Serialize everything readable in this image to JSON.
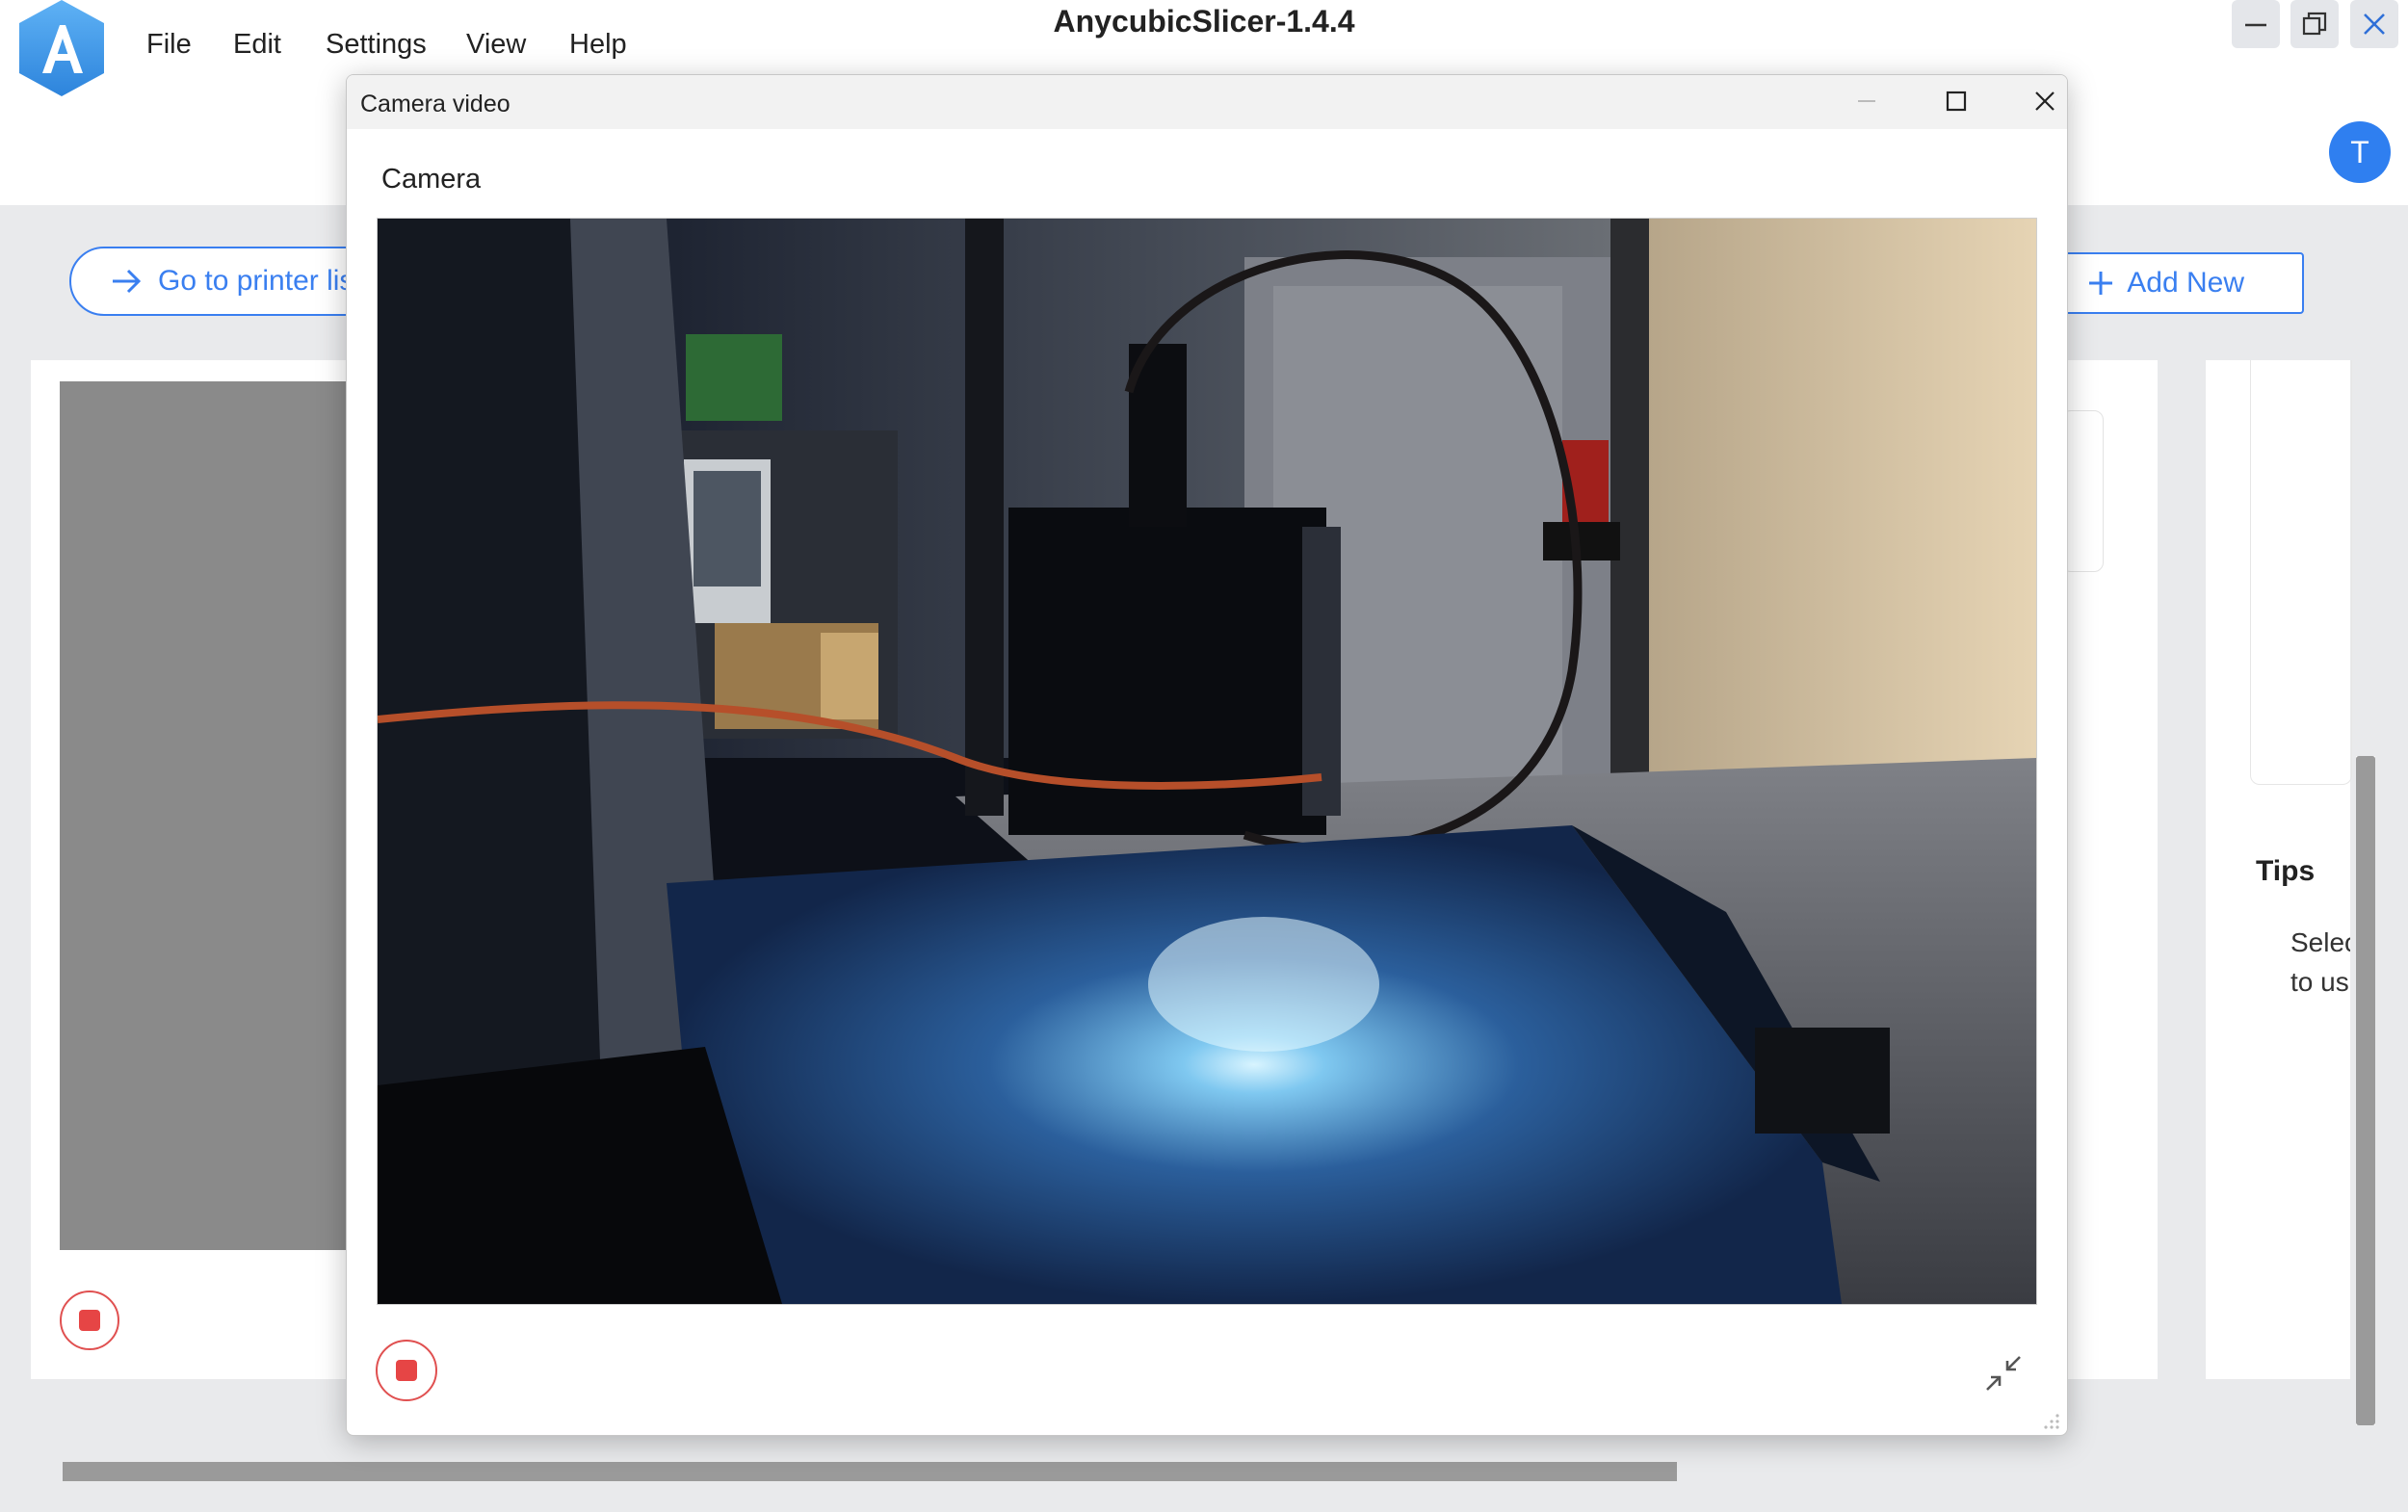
{
  "app": {
    "title": "AnycubicSlicer-1.4.4",
    "menu": [
      "File",
      "Edit",
      "Settings",
      "View",
      "Help"
    ],
    "avatar_initial": "T"
  },
  "main": {
    "goto_printer_label": "Go to printer lis",
    "add_new_label": "Add New",
    "tips": {
      "title": "Tips",
      "line1": "Selec",
      "line2": "to us"
    }
  },
  "dialog": {
    "title": "Camera video",
    "section_label": "Camera"
  },
  "colors": {
    "accent": "#3a7ff0",
    "stop_red": "#e64545",
    "avatar_blue": "#2f7ff0"
  },
  "icons": {
    "app_logo": "anycubic-logo-icon",
    "minimize": "minimize-icon",
    "restore": "restore-icon",
    "maximize": "maximize-icon",
    "close": "close-icon",
    "arrow_right": "arrow-right-icon",
    "plus": "plus-icon",
    "stop": "stop-icon",
    "shrink": "shrink-icon"
  }
}
